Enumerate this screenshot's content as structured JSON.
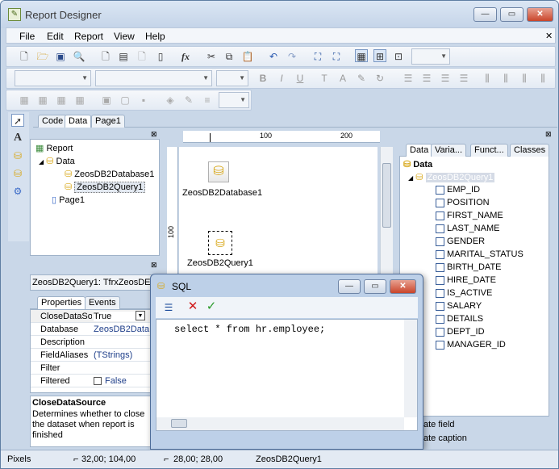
{
  "window": {
    "title": "Report Designer",
    "controls": [
      "minimize",
      "maximize",
      "close"
    ]
  },
  "menu": [
    "File",
    "Edit",
    "Report",
    "View",
    "Help"
  ],
  "toolbar": {
    "fx_label": "fx",
    "icons": [
      "new-icon",
      "open-icon",
      "save-icon",
      "preview-icon",
      "new-page-icon",
      "new-dialog-icon",
      "delete-page-icon",
      "page-settings-icon",
      "function-icon",
      "cut-icon",
      "copy-icon",
      "paste-icon",
      "undo-icon",
      "redo-icon",
      "group-icon",
      "ungroup-icon",
      "grid-icon",
      "align-grid-icon",
      "fit-grid-icon"
    ]
  },
  "designer_tabs": [
    "Code",
    "Data",
    "Page1"
  ],
  "tree": {
    "root": "Report",
    "data": "Data",
    "items": [
      "ZeosDB2Database1",
      "ZeosDB2Query1"
    ],
    "page": "Page1"
  },
  "ruler": {
    "marks": [
      "100",
      "200"
    ],
    "left_mark": "100"
  },
  "canvas": {
    "db_label": "ZeosDB2Database1",
    "query_label": "ZeosDB2Query1"
  },
  "object_inspector": {
    "selected": "ZeosDB2Query1: TfrxZeosDE",
    "tabs": [
      "Properties",
      "Events"
    ],
    "properties": [
      {
        "name": "CloseDataSource",
        "value": "True"
      },
      {
        "name": "Database",
        "value": "ZeosDB2Data"
      },
      {
        "name": "Description",
        "value": ""
      },
      {
        "name": "FieldAliases",
        "value": "(TStrings)"
      },
      {
        "name": "Filter",
        "value": ""
      },
      {
        "name": "Filtered",
        "value": "False"
      }
    ],
    "help_title": "CloseDataSource",
    "help_text": "Determines whether to close the dataset when report is finished"
  },
  "data_tree": {
    "tabs": [
      "Data",
      "Varia...",
      "Funct...",
      "Classes"
    ],
    "root": "Data",
    "query": "ZeosDB2Query1",
    "fields": [
      "EMP_ID",
      "POSITION",
      "FIRST_NAME",
      "LAST_NAME",
      "GENDER",
      "MARITAL_STATUS",
      "BIRTH_DATE",
      "HIRE_DATE",
      "IS_ACTIVE",
      "SALARY",
      "DETAILS",
      "DEPT_ID",
      "MANAGER_ID"
    ],
    "options": [
      "ate field",
      "ate caption"
    ]
  },
  "sql_dialog": {
    "title": "SQL",
    "text": "select * from hr.employee;"
  },
  "status": {
    "units": "Pixels",
    "position": "32,00; 104,00",
    "size": "28,00; 28,00",
    "object": "ZeosDB2Query1"
  }
}
